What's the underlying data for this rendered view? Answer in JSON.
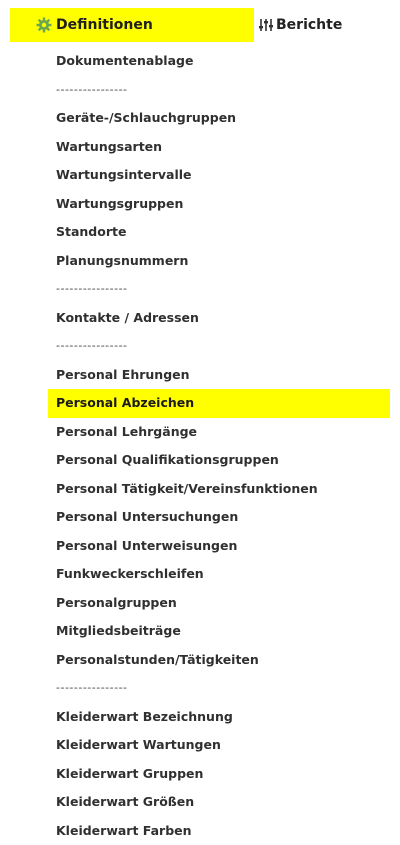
{
  "tabs": {
    "definitionen": {
      "label": "Definitionen",
      "icon": "gear-icon",
      "highlighted": true
    },
    "berichte": {
      "label": "Berichte",
      "icon": "sliders-icon"
    }
  },
  "colors": {
    "highlight": "#ffff00",
    "gear": "#6aa84f",
    "text": "#2c2c2c"
  },
  "menu": {
    "items": [
      {
        "label": "Dokumentenablage",
        "type": "link"
      },
      {
        "label": "----------------",
        "type": "separator"
      },
      {
        "label": "Geräte-/Schlauchgruppen",
        "type": "link"
      },
      {
        "label": "Wartungsarten",
        "type": "link"
      },
      {
        "label": "Wartungsintervalle",
        "type": "link"
      },
      {
        "label": "Wartungsgruppen",
        "type": "link"
      },
      {
        "label": "Standorte",
        "type": "link"
      },
      {
        "label": "Planungsnummern",
        "type": "link"
      },
      {
        "label": "----------------",
        "type": "separator"
      },
      {
        "label": "Kontakte / Adressen",
        "type": "link"
      },
      {
        "label": "----------------",
        "type": "separator"
      },
      {
        "label": "Personal Ehrungen",
        "type": "link"
      },
      {
        "label": "Personal Abzeichen",
        "type": "link",
        "highlighted": true
      },
      {
        "label": "Personal Lehrgänge",
        "type": "link"
      },
      {
        "label": "Personal Qualifikationsgruppen",
        "type": "link"
      },
      {
        "label": "Personal Tätigkeit/Vereinsfunktionen",
        "type": "link"
      },
      {
        "label": "Personal Untersuchungen",
        "type": "link"
      },
      {
        "label": "Personal Unterweisungen",
        "type": "link"
      },
      {
        "label": "Funkweckerschleifen",
        "type": "link"
      },
      {
        "label": "Personalgruppen",
        "type": "link"
      },
      {
        "label": "Mitgliedsbeiträge",
        "type": "link"
      },
      {
        "label": "Personalstunden/Tätigkeiten",
        "type": "link"
      },
      {
        "label": "----------------",
        "type": "separator"
      },
      {
        "label": "Kleiderwart Bezeichnung",
        "type": "link"
      },
      {
        "label": "Kleiderwart Wartungen",
        "type": "link"
      },
      {
        "label": "Kleiderwart Gruppen",
        "type": "link"
      },
      {
        "label": "Kleiderwart Größen",
        "type": "link"
      },
      {
        "label": "Kleiderwart Farben",
        "type": "link"
      }
    ]
  }
}
